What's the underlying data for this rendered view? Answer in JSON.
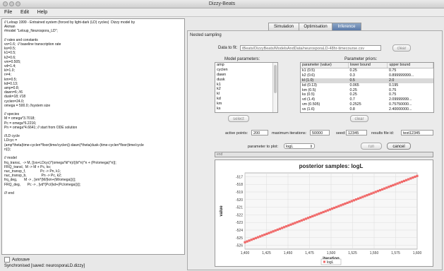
{
  "window": {
    "title": "Dizzy-Beats"
  },
  "menu": [
    "File",
    "Edit",
    "Help"
  ],
  "editor": {
    "lines": [
      "// Leloup 1999 - Entrained system (forced by light-dark (LD) cycles)  Dizzy model by",
      "Akman",
      "#model \"Leloup_Neurospora_LD\";",
      "",
      "// rates and constants",
      "vs=1.6;  // baseline transcription rate",
      "ks=0.5;",
      "k1=0.5;",
      "k2=0.6;",
      "vm=0.505;",
      "vd=1.4;",
      "kl=1.0;",
      "n=4;",
      "km=0.5;",
      "kd=0.13;",
      "amp=0.8;",
      "dawn=6; //6",
      "dusk=18; //18",
      "cyclen=24.0;",
      "omega = 500.0; //system size",
      "",
      "// species",
      "M = omega*3.7018;",
      "Pc = omega*6.2216;",
      "Pn = omega*4.6641; // start from ODE solution",
      "",
      "//LD cycle",
      "LDcyc =",
      "(amp*theta(time-cyclen*floor(time/cyclen))-dawn)*theta(dusk-(time-cyclen*floor(time/cycle",
      "n)));",
      "",
      "// model",
      "frq_transc,  -> M, [(vs+LDcyc)*(omega*kl^n)/((kl^n)^n + (Pn/omega)^n)];",
      "FRQ_transl,  M -> M + Pc, ks;",
      "nuc_transp_f,               Pc -> Pn, k1;",
      "nuc_transp_b,               Pn -> Pc, k2;",
      "frq_deg,       M -> , [vm*(M/(km+(M/omega)))];",
      "FRQ_deg,       Pc -> , [vd*(Pc/(kd+(Pc/omega)))];",
      "",
      "/// end"
    ]
  },
  "autosave": {
    "label": "Autosave"
  },
  "status": "Synchronised [saved: neurosporaLD.dizzy]",
  "tabs": [
    "Simulation",
    "Optimisation",
    "Inference"
  ],
  "nested": {
    "title": "Nested sampling",
    "data_label": "Data to fit:",
    "data_path": "tBeats/DizzyBeats/ModelsAndData/neurosporaLD-48hr-timecourse.csv",
    "clear": "clear",
    "model_params_title": "Model parameters:",
    "model_params": [
      "amp",
      "cyclen",
      "dawn",
      "dusk",
      "k1",
      "k2",
      "kl",
      "kd",
      "km",
      "ks"
    ],
    "select": "select",
    "priors_title": "Parameter priors:",
    "priors_headers": [
      "parameter (value)",
      "lower bound",
      "upper bound"
    ],
    "priors": [
      [
        "k1 (0.5)",
        "0.25",
        "0.75"
      ],
      [
        "k2 (0.6)",
        "0.3",
        "0.899999999..."
      ],
      [
        "kl (1.0)",
        "0.5",
        "2.0"
      ],
      [
        "kd (0.13)",
        "0.065",
        "0.195"
      ],
      [
        "km (0.5)",
        "0.25",
        "0.75"
      ],
      [
        "ks (0.5)",
        "0.25",
        "0.75"
      ],
      [
        "vd (1.4)",
        "0.7",
        "2.09999999..."
      ],
      [
        "vm (0.505)",
        "0.2525",
        "0.75750000..."
      ],
      [
        "vs (1.6)",
        "0.8",
        "2.40000000..."
      ]
    ],
    "priors_clear": "clear",
    "active_label": "active points:",
    "active_value": "200",
    "maxiter_label": "maximum iterations:",
    "maxiter_value": "50000",
    "seed_label": "seed:",
    "seed_value": "12345",
    "results_label": "results file id:",
    "results_value": "test12345",
    "plot_label": "parameter to plot:",
    "plot_value": "logL",
    "run": "run",
    "cancel": "cancel",
    "progress_text": "end"
  },
  "chart_data": {
    "type": "scatter",
    "title": "posterior samples: logL",
    "xlabel": "iteration",
    "ylabel": "value",
    "xlim": [
      1400,
      1600
    ],
    "ylim": [
      -526.5,
      -516.5
    ],
    "xticks": [
      1400,
      1425,
      1450,
      1475,
      1500,
      1525,
      1550,
      1575,
      1600
    ],
    "yticks": [
      -517,
      -518,
      -519,
      -520,
      -521,
      -522,
      -523,
      -524,
      -525,
      -526
    ],
    "legend": [
      "logL"
    ],
    "series_color": "#f06a6a",
    "series": [
      {
        "name": "logL",
        "x_start": 1400,
        "x_end": 1600,
        "y_start": -525.6,
        "y_end": -516.9
      }
    ]
  }
}
